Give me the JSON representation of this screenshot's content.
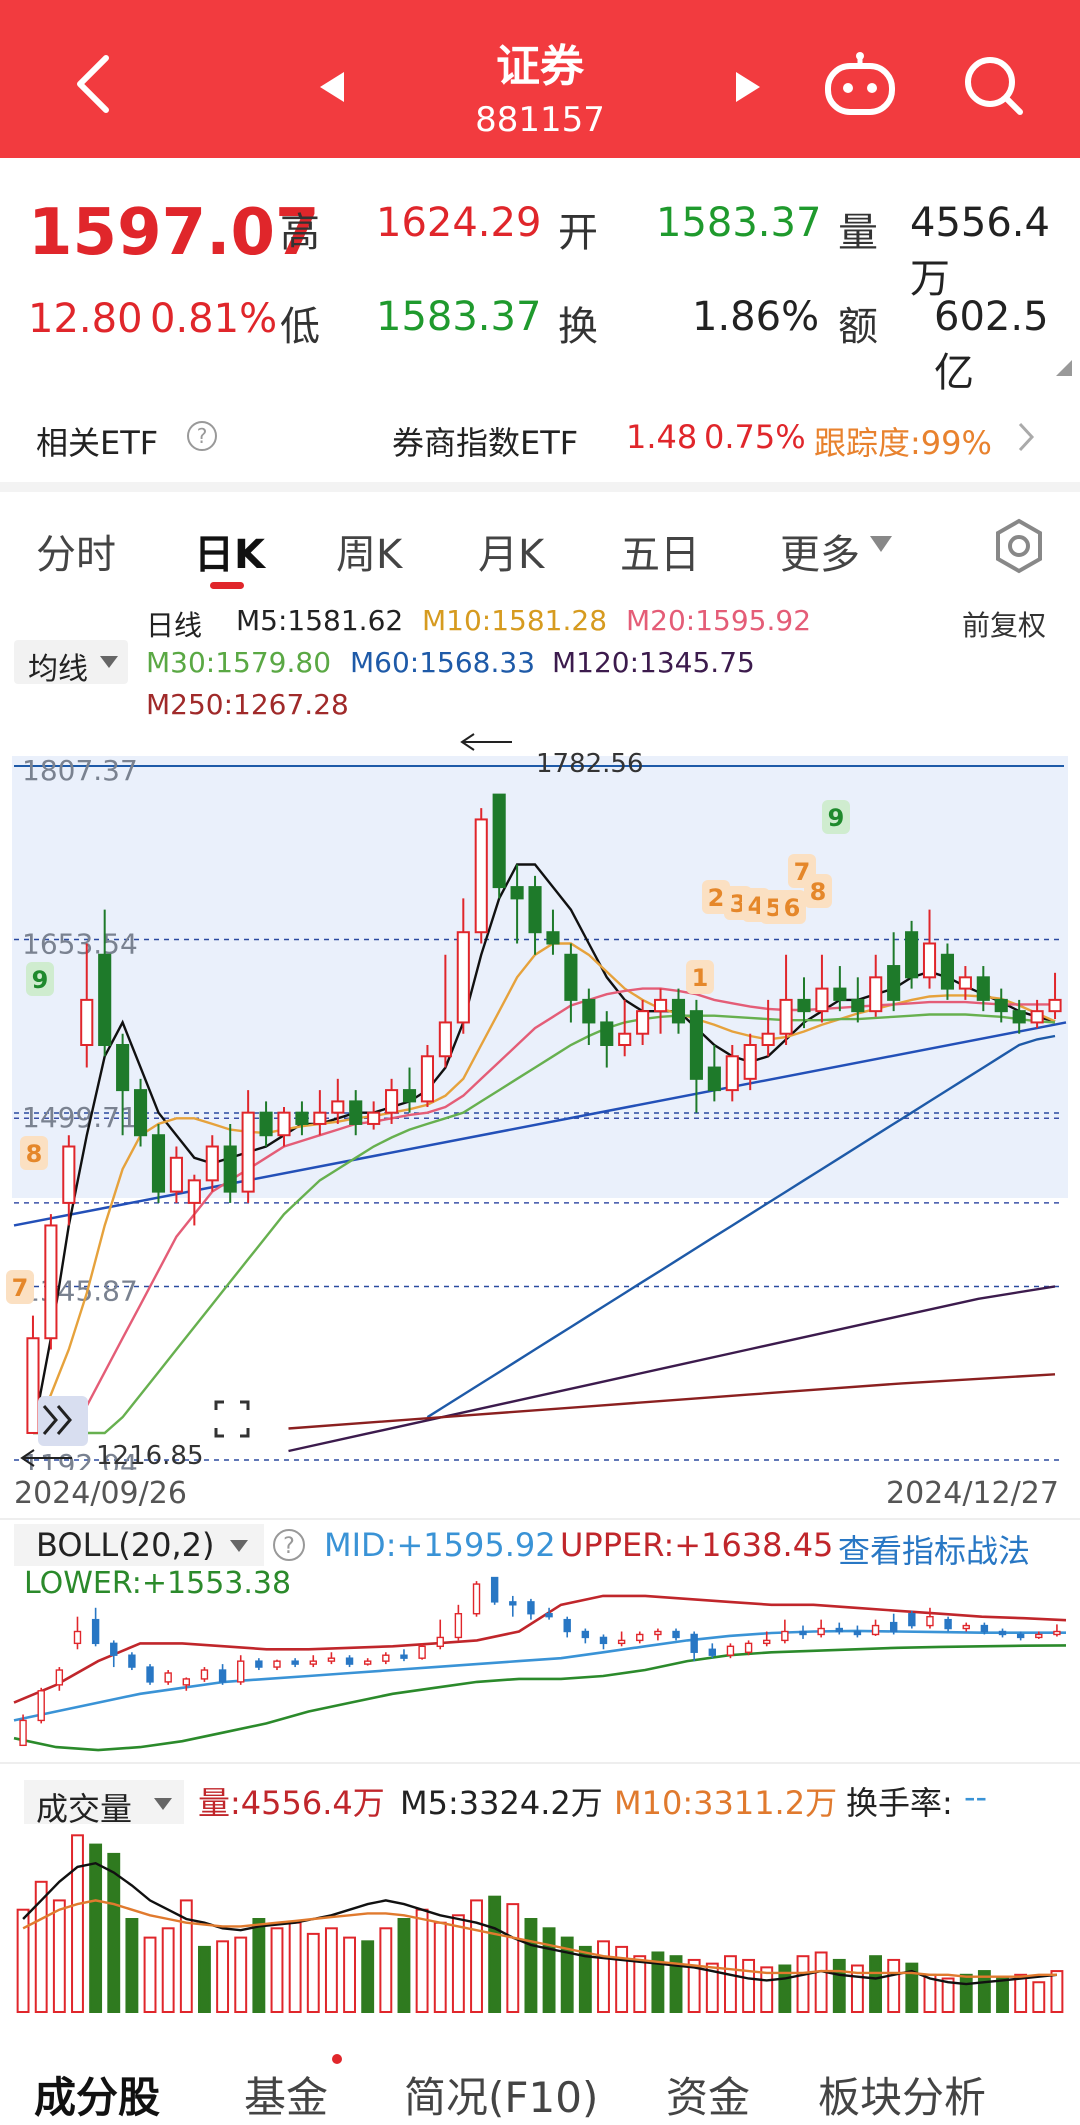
{
  "header": {
    "title": "证券",
    "code": "881157"
  },
  "quote": {
    "price": "1597.07",
    "change": "12.80",
    "change_pct": "0.81%",
    "high_label": "高",
    "high": "1624.29",
    "low_label": "低",
    "low": "1583.37",
    "open_label": "开",
    "open": "1583.37",
    "turnover_label": "换",
    "turnover": "1.86%",
    "volume_label": "量",
    "volume": "4556.4万",
    "amount_label": "额",
    "amount": "602.5亿"
  },
  "etf": {
    "label": "相关ETF",
    "name": "券商指数ETF",
    "price": "1.48",
    "pct": "0.75%",
    "tracking": "跟踪度:99%"
  },
  "tabs": [
    {
      "label": "分时"
    },
    {
      "label": "日K"
    },
    {
      "label": "周K"
    },
    {
      "label": "月K"
    },
    {
      "label": "五日"
    },
    {
      "label": "更多"
    }
  ],
  "ma": {
    "selector": "均线",
    "mode": "前复权",
    "kline": "日线",
    "m5": "M5:1581.62",
    "m10": "M10:1581.28",
    "m20": "M20:1595.92",
    "m30": "M30:1579.80",
    "m60": "M60:1568.33",
    "m120": "M120:1345.75",
    "m250": "M250:1267.28"
  },
  "chart_data": [
    {
      "type": "candlestick",
      "y_ticks": [
        "1807.37",
        "1653.54",
        "1499.71",
        "1345.87",
        "1192.04"
      ],
      "y_range": [
        1192.04,
        1807.37
      ],
      "x_start": "2024/09/26",
      "x_end": "2024/12/27",
      "high_annotation": "1782.56",
      "low_annotation": "1216.85",
      "markers": [
        "9",
        "8",
        "7",
        "9",
        "1",
        "2",
        "3",
        "4",
        "5",
        "6",
        "7",
        "8"
      ],
      "candles": [
        {
          "o": 1216,
          "c": 1300,
          "h": 1320,
          "l": 1216
        },
        {
          "o": 1300,
          "c": 1400,
          "h": 1410,
          "l": 1290
        },
        {
          "o": 1420,
          "c": 1470,
          "h": 1480,
          "l": 1400
        },
        {
          "o": 1560,
          "c": 1600,
          "h": 1650,
          "l": 1540
        },
        {
          "o": 1640,
          "c": 1560,
          "h": 1680,
          "l": 1550
        },
        {
          "o": 1560,
          "c": 1520,
          "h": 1570,
          "l": 1480
        },
        {
          "o": 1520,
          "c": 1480,
          "h": 1530,
          "l": 1470
        },
        {
          "o": 1480,
          "c": 1430,
          "h": 1490,
          "l": 1420
        },
        {
          "o": 1430,
          "c": 1460,
          "h": 1470,
          "l": 1420
        },
        {
          "o": 1420,
          "c": 1440,
          "h": 1445,
          "l": 1400
        },
        {
          "o": 1440,
          "c": 1470,
          "h": 1480,
          "l": 1430
        },
        {
          "o": 1470,
          "c": 1430,
          "h": 1490,
          "l": 1420
        },
        {
          "o": 1430,
          "c": 1500,
          "h": 1520,
          "l": 1420
        },
        {
          "o": 1500,
          "c": 1480,
          "h": 1510,
          "l": 1470
        },
        {
          "o": 1480,
          "c": 1500,
          "h": 1505,
          "l": 1470
        },
        {
          "o": 1500,
          "c": 1490,
          "h": 1510,
          "l": 1480
        },
        {
          "o": 1490,
          "c": 1500,
          "h": 1520,
          "l": 1480
        },
        {
          "o": 1500,
          "c": 1510,
          "h": 1530,
          "l": 1490
        },
        {
          "o": 1510,
          "c": 1490,
          "h": 1520,
          "l": 1480
        },
        {
          "o": 1490,
          "c": 1500,
          "h": 1510,
          "l": 1485
        },
        {
          "o": 1500,
          "c": 1520,
          "h": 1530,
          "l": 1490
        },
        {
          "o": 1520,
          "c": 1510,
          "h": 1540,
          "l": 1500
        },
        {
          "o": 1510,
          "c": 1550,
          "h": 1560,
          "l": 1505
        },
        {
          "o": 1550,
          "c": 1580,
          "h": 1640,
          "l": 1540
        },
        {
          "o": 1580,
          "c": 1660,
          "h": 1690,
          "l": 1570
        },
        {
          "o": 1660,
          "c": 1760,
          "h": 1770,
          "l": 1650
        },
        {
          "o": 1782,
          "c": 1700,
          "h": 1782,
          "l": 1690
        },
        {
          "o": 1700,
          "c": 1690,
          "h": 1720,
          "l": 1650
        },
        {
          "o": 1700,
          "c": 1660,
          "h": 1710,
          "l": 1640
        },
        {
          "o": 1660,
          "c": 1650,
          "h": 1680,
          "l": 1640
        },
        {
          "o": 1640,
          "c": 1600,
          "h": 1650,
          "l": 1580
        },
        {
          "o": 1600,
          "c": 1580,
          "h": 1610,
          "l": 1560
        },
        {
          "o": 1580,
          "c": 1560,
          "h": 1590,
          "l": 1540
        },
        {
          "o": 1560,
          "c": 1570,
          "h": 1600,
          "l": 1550
        },
        {
          "o": 1570,
          "c": 1590,
          "h": 1600,
          "l": 1560
        },
        {
          "o": 1590,
          "c": 1600,
          "h": 1610,
          "l": 1570
        },
        {
          "o": 1600,
          "c": 1580,
          "h": 1610,
          "l": 1570
        },
        {
          "o": 1590,
          "c": 1530,
          "h": 1600,
          "l": 1500
        },
        {
          "o": 1540,
          "c": 1520,
          "h": 1560,
          "l": 1510
        },
        {
          "o": 1520,
          "c": 1550,
          "h": 1560,
          "l": 1510
        },
        {
          "o": 1530,
          "c": 1560,
          "h": 1570,
          "l": 1520
        },
        {
          "o": 1560,
          "c": 1570,
          "h": 1600,
          "l": 1550
        },
        {
          "o": 1570,
          "c": 1600,
          "h": 1640,
          "l": 1560
        },
        {
          "o": 1600,
          "c": 1590,
          "h": 1620,
          "l": 1575
        },
        {
          "o": 1590,
          "c": 1610,
          "h": 1640,
          "l": 1580
        },
        {
          "o": 1610,
          "c": 1600,
          "h": 1630,
          "l": 1590
        },
        {
          "o": 1600,
          "c": 1590,
          "h": 1620,
          "l": 1580
        },
        {
          "o": 1590,
          "c": 1620,
          "h": 1640,
          "l": 1585
        },
        {
          "o": 1630,
          "c": 1600,
          "h": 1660,
          "l": 1590
        },
        {
          "o": 1660,
          "c": 1620,
          "h": 1670,
          "l": 1610
        },
        {
          "o": 1620,
          "c": 1650,
          "h": 1680,
          "l": 1610
        },
        {
          "o": 1640,
          "c": 1610,
          "h": 1650,
          "l": 1600
        },
        {
          "o": 1610,
          "c": 1620,
          "h": 1630,
          "l": 1600
        },
        {
          "o": 1620,
          "c": 1600,
          "h": 1630,
          "l": 1590
        },
        {
          "o": 1600,
          "c": 1590,
          "h": 1610,
          "l": 1580
        },
        {
          "o": 1590,
          "c": 1580,
          "h": 1600,
          "l": 1570
        },
        {
          "o": 1580,
          "c": 1590,
          "h": 1600,
          "l": 1575
        },
        {
          "o": 1590,
          "c": 1600,
          "h": 1624,
          "l": 1583
        }
      ],
      "series": [
        {
          "name": "M5",
          "color": "#111111",
          "values": [
            1216,
            1300,
            1400,
            1480,
            1550,
            1580,
            1540,
            1500,
            1480,
            1460,
            1455,
            1460,
            1465,
            1470,
            1480,
            1490,
            1490,
            1495,
            1500,
            1500,
            1505,
            1510,
            1520,
            1540,
            1580,
            1640,
            1690,
            1720,
            1720,
            1700,
            1680,
            1650,
            1620,
            1600,
            1590,
            1590,
            1590,
            1575,
            1560,
            1550,
            1545,
            1550,
            1565,
            1580,
            1590,
            1600,
            1600,
            1605,
            1610,
            1620,
            1625,
            1620,
            1612,
            1605,
            1598,
            1590,
            1585,
            1581
          ]
        },
        {
          "name": "M10",
          "color": "#e6a23c",
          "values": [
            1216,
            1250,
            1290,
            1340,
            1400,
            1450,
            1480,
            1490,
            1495,
            1495,
            1490,
            1485,
            1483,
            1482,
            1485,
            1488,
            1490,
            1492,
            1495,
            1497,
            1500,
            1503,
            1507,
            1515,
            1530,
            1560,
            1590,
            1620,
            1640,
            1650,
            1650,
            1640,
            1625,
            1610,
            1600,
            1592,
            1588,
            1583,
            1578,
            1572,
            1568,
            1565,
            1567,
            1572,
            1578,
            1583,
            1588,
            1592,
            1596,
            1600,
            1603,
            1604,
            1604,
            1603,
            1601,
            1595,
            1588,
            1581
          ]
        },
        {
          "name": "M20",
          "color": "#e45d77",
          "values": [
            1216,
            1216,
            1220,
            1240,
            1270,
            1300,
            1330,
            1360,
            1390,
            1410,
            1430,
            1440,
            1450,
            1460,
            1470,
            1475,
            1480,
            1485,
            1490,
            1492,
            1495,
            1498,
            1500,
            1505,
            1515,
            1530,
            1545,
            1560,
            1575,
            1585,
            1595,
            1600,
            1605,
            1608,
            1610,
            1610,
            1608,
            1605,
            1600,
            1597,
            1594,
            1592,
            1591,
            1591,
            1592,
            1593,
            1594,
            1595,
            1596,
            1597,
            1598,
            1598,
            1598,
            1597,
            1596,
            1596,
            1596,
            1596
          ]
        },
        {
          "name": "M30",
          "color": "#67b04f",
          "values": [
            1216,
            1216,
            1216,
            1216,
            1216,
            1230,
            1250,
            1270,
            1290,
            1310,
            1330,
            1350,
            1370,
            1390,
            1410,
            1425,
            1440,
            1450,
            1460,
            1470,
            1478,
            1485,
            1490,
            1495,
            1500,
            1510,
            1520,
            1530,
            1540,
            1550,
            1560,
            1568,
            1575,
            1580,
            1583,
            1585,
            1586,
            1586,
            1586,
            1585,
            1584,
            1583,
            1582,
            1582,
            1582,
            1583,
            1583,
            1584,
            1585,
            1586,
            1587,
            1587,
            1587,
            1586,
            1585,
            1583,
            1581,
            1580
          ]
        },
        {
          "name": "M60",
          "color": "#1e5aa8",
          "values": [
            1230,
            1240,
            1250,
            1260,
            1270,
            1280,
            1290,
            1300,
            1310,
            1320,
            1330,
            1340,
            1350,
            1360,
            1370,
            1380,
            1390,
            1400,
            1410,
            1420,
            1430,
            1440,
            1450,
            1460,
            1470,
            1480,
            1490,
            1500,
            1510,
            1520,
            1530,
            1540,
            1550,
            1560,
            1565,
            1568
          ]
        },
        {
          "name": "M120",
          "color": "#3c1b4d",
          "values": [
            1200,
            1215,
            1230,
            1245,
            1260,
            1275,
            1290,
            1305,
            1320,
            1335,
            1346
          ]
        },
        {
          "name": "M250",
          "color": "#8b2020",
          "values": [
            1220,
            1230,
            1240,
            1250,
            1260,
            1268
          ]
        }
      ]
    },
    {
      "type": "bollinger",
      "selector": "BOLL(20,2)",
      "mid_label": "MID:+1595.92",
      "upper_label": "UPPER:+1638.45",
      "lower_label": "LOWER:+1553.38",
      "link": "查看指标战法",
      "series": [
        {
          "name": "MID",
          "color": "#3a93d6",
          "values": [
            1300,
            1330,
            1360,
            1390,
            1410,
            1430,
            1440,
            1450,
            1460,
            1470,
            1480,
            1490,
            1500,
            1510,
            1530,
            1550,
            1570,
            1585,
            1595,
            1600,
            1602,
            1600,
            1598,
            1596,
            1596,
            1596
          ]
        },
        {
          "name": "UPPER",
          "color": "#c0262b",
          "values": [
            1360,
            1420,
            1500,
            1560,
            1560,
            1550,
            1540,
            1540,
            1545,
            1550,
            1560,
            1570,
            1600,
            1690,
            1720,
            1720,
            1710,
            1700,
            1690,
            1690,
            1680,
            1670,
            1660,
            1650,
            1645,
            1638
          ]
        },
        {
          "name": "LOWER",
          "color": "#2b8a2b",
          "values": [
            1240,
            1210,
            1200,
            1210,
            1230,
            1260,
            1290,
            1330,
            1360,
            1390,
            1410,
            1430,
            1440,
            1440,
            1450,
            1470,
            1500,
            1520,
            1530,
            1535,
            1540,
            1545,
            1548,
            1550,
            1552,
            1553
          ]
        }
      ]
    },
    {
      "type": "bar",
      "selector": "成交量",
      "vol_label": "量:4556.4万",
      "m5_label": "M5:3324.2万",
      "m10_label": "M10:3311.2万",
      "turnover_label": "换手率:",
      "turnover_value": "--",
      "values": [
        55,
        70,
        60,
        95,
        90,
        85,
        50,
        40,
        45,
        60,
        35,
        38,
        40,
        50,
        45,
        48,
        42,
        45,
        40,
        38,
        45,
        50,
        55,
        48,
        52,
        60,
        62,
        58,
        50,
        45,
        40,
        35,
        38,
        35,
        30,
        32,
        30,
        28,
        26,
        30,
        28,
        24,
        25,
        30,
        32,
        28,
        25,
        30,
        28,
        26,
        20,
        18,
        20,
        22,
        18,
        20,
        16,
        22
      ],
      "up": [
        1,
        1,
        1,
        1,
        0,
        0,
        0,
        1,
        1,
        1,
        0,
        1,
        1,
        0,
        1,
        1,
        1,
        1,
        1,
        0,
        1,
        0,
        1,
        1,
        1,
        1,
        0,
        1,
        0,
        0,
        0,
        0,
        1,
        1,
        1,
        0,
        0,
        1,
        1,
        1,
        1,
        1,
        0,
        1,
        1,
        0,
        1,
        0,
        1,
        0,
        1,
        1,
        0,
        0,
        0,
        1,
        1,
        1
      ],
      "series": [
        {
          "name": "M5",
          "color": "#111111",
          "values": [
            50,
            60,
            70,
            78,
            80,
            75,
            68,
            60,
            55,
            50,
            48,
            45,
            44,
            46,
            47,
            48,
            50,
            52,
            55,
            58,
            60,
            58,
            55,
            52,
            50,
            48,
            45,
            40,
            36,
            34,
            32,
            30,
            29,
            28,
            27,
            26,
            25,
            24,
            22,
            20,
            18,
            17,
            18,
            20,
            22,
            20,
            19,
            18,
            20,
            22,
            18,
            16,
            15,
            16,
            17,
            18,
            19,
            20
          ]
        },
        {
          "name": "M10",
          "color": "#e07a2e",
          "values": [
            45,
            50,
            55,
            58,
            60,
            58,
            55,
            52,
            50,
            48,
            47,
            46,
            46,
            47,
            48,
            49,
            50,
            51,
            52,
            53,
            53,
            52,
            50,
            48,
            46,
            44,
            42,
            40,
            38,
            36,
            34,
            32,
            30,
            29,
            28,
            27,
            26,
            25,
            24,
            23,
            22,
            21,
            21,
            21,
            22,
            22,
            21,
            21,
            21,
            21,
            20,
            20,
            19,
            19,
            19,
            19,
            20,
            20
          ]
        }
      ]
    }
  ],
  "bottom_tabs": [
    {
      "label": "成分股"
    },
    {
      "label": "基金"
    },
    {
      "label": "简况(F10)"
    },
    {
      "label": "资金"
    },
    {
      "label": "板块分析"
    }
  ]
}
